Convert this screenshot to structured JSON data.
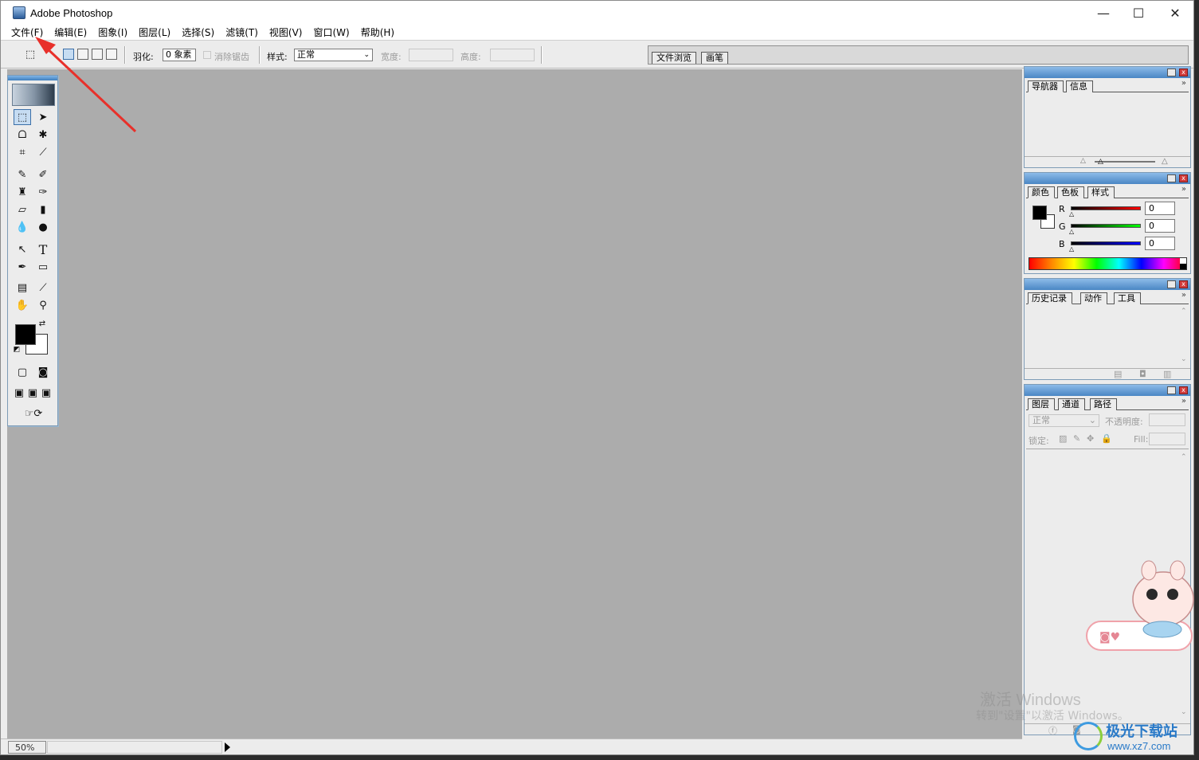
{
  "titlebar": {
    "title": "Adobe Photoshop",
    "minimize": "—",
    "maximize": "☐",
    "close": "✕"
  },
  "menubar": {
    "items": [
      "文件(F)",
      "编辑(E)",
      "图象(I)",
      "图层(L)",
      "选择(S)",
      "滤镜(T)",
      "视图(V)",
      "窗口(W)",
      "帮助(H)"
    ]
  },
  "options": {
    "feather_label": "羽化:",
    "feather_value": "0 象素",
    "antialias_label": "消除锯齿",
    "style_label": "样式:",
    "style_value": "正常",
    "width_label": "宽度:",
    "height_label": "高度:"
  },
  "palette_well": {
    "tabs": [
      "文件浏览",
      "画笔"
    ]
  },
  "panels": {
    "navigator": {
      "tabs": [
        "导航器",
        "信息"
      ]
    },
    "color": {
      "tabs": [
        "颜色",
        "色板",
        "样式"
      ],
      "r_label": "R",
      "g_label": "G",
      "b_label": "B",
      "r": "0",
      "g": "0",
      "b": "0"
    },
    "history": {
      "tabs": [
        "历史记录",
        "动作",
        "工具"
      ]
    },
    "layers": {
      "tabs": [
        "图层",
        "通道",
        "路径"
      ],
      "blend_mode": "正常",
      "opacity_label": "不透明度:",
      "lock_label": "锁定:",
      "fill_label": "Fill:"
    }
  },
  "statusbar": {
    "zoom": "50%"
  },
  "colors": {
    "canvas": "#acacac",
    "foreground": "#000000",
    "background": "#ffffff",
    "accent": "#4a86c4",
    "arrow": "#e8302a"
  },
  "overlay": {
    "watermark_line1": "激活 Windows",
    "watermark_line2": "转到\"设置\"以激活 Windows。",
    "site_brand": "极光下载站",
    "site_url": "www.xz7.com"
  }
}
